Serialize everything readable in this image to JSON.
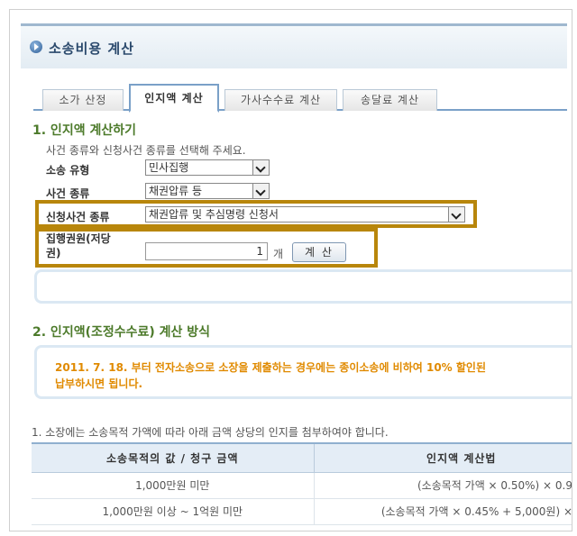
{
  "header": {
    "title": "소송비용 계산"
  },
  "tabs": [
    {
      "label": "소가 산정",
      "active": false
    },
    {
      "label": "인지액 계산",
      "active": true
    },
    {
      "label": "가사수수료 계산",
      "active": false
    },
    {
      "label": "송달료 계산",
      "active": false
    }
  ],
  "section1": {
    "title": "1. 인지액 계산하기",
    "description": "사건 종류와 신청사건 종류를 선택해 주세요.",
    "fields": {
      "lawsuit_type": {
        "label": "소송 유형",
        "value": "민사집행"
      },
      "case_type": {
        "label": "사건 종류",
        "value": "채권압류 등"
      },
      "application_type": {
        "label": "신청사건 종류",
        "value": "채권압류 및 추심명령 신청서"
      },
      "enforcement_title": {
        "label_line1": "집행권원(저당",
        "label_line2": "권)",
        "value": "1",
        "unit": "개"
      }
    },
    "calc_button": "계 산"
  },
  "section2": {
    "title": "2. 인지액(조정수수료) 계산 방식",
    "notice_line1": "2011. 7. 18. 부터 전자소송으로 소장을 제출하는 경우에는 종이소송에 비하여 10% 할인된",
    "notice_line2": "납부하시면 됩니다."
  },
  "fee_table": {
    "intro": "1. 소장에는 소송목적 가액에 따라 아래 금액 상당의 인지를 첨부하여야 합니다.",
    "headers": [
      "소송목적의 값 / 청구 금액",
      "인지액 계산법"
    ],
    "rows": [
      [
        "1,000만원 미만",
        "(소송목적 가액 × 0.50%) × 0.9"
      ],
      [
        "1,000만원 이상 ~ 1억원 미만",
        "(소송목적 가액 × 0.45% + 5,000원) ×"
      ]
    ]
  },
  "colors": {
    "highlight": "#b8860b",
    "section_title": "#4c7a2a",
    "notice": "#e08a00",
    "tab_border": "#7aa0c8"
  }
}
